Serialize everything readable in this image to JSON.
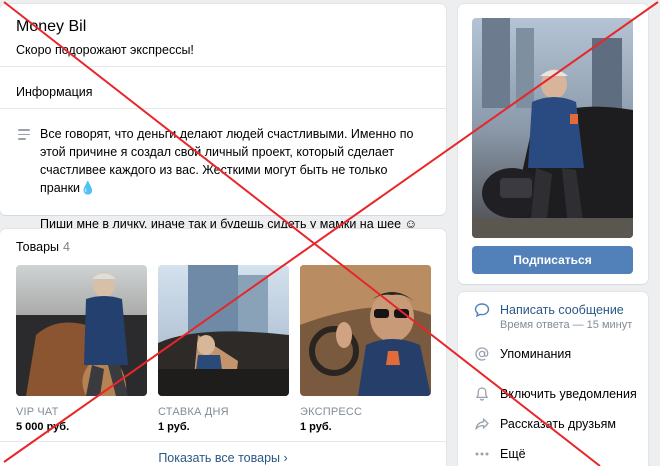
{
  "profile": {
    "name": "Money Bil",
    "status": "Скоро подорожают экспрессы!",
    "info_title": "Информация",
    "about_1": "Все говорят, что деньги делают людей счастливыми. Именно по этой причине я создал свой личный проект, который сделает счастливее каждого из вас. Жесткими могут быть не только пранки💧",
    "about_2": "Пиши мне в личку, иначе так и будешь сидеть у мамки на шее ☺"
  },
  "goods": {
    "title": "Товары",
    "count": "4",
    "items": [
      {
        "name": "VIP ЧАТ",
        "price": "5 000 руб."
      },
      {
        "name": "СТАВКА ДНЯ",
        "price": "1 руб."
      },
      {
        "name": "ЭКСПРЕСС",
        "price": "1 руб."
      }
    ],
    "show_all": "Показать все товары ›"
  },
  "sidebar": {
    "subscribe_label": "Подписаться",
    "actions": [
      {
        "label": "Написать сообщение",
        "sub": "Время ответа — 15 минут",
        "icon": "message-icon"
      },
      {
        "label": "Упоминания",
        "icon": "at-icon"
      },
      {
        "label": "Включить уведомления",
        "icon": "bell-icon"
      },
      {
        "label": "Рассказать друзьям",
        "icon": "share-icon"
      },
      {
        "label": "Ещё",
        "icon": "more-icon"
      }
    ]
  },
  "overlay": {
    "cross_color": "#e8262a"
  },
  "colors": {
    "accent": "#5181b8",
    "link": "#2a5885",
    "page_bg": "#edeef0"
  }
}
